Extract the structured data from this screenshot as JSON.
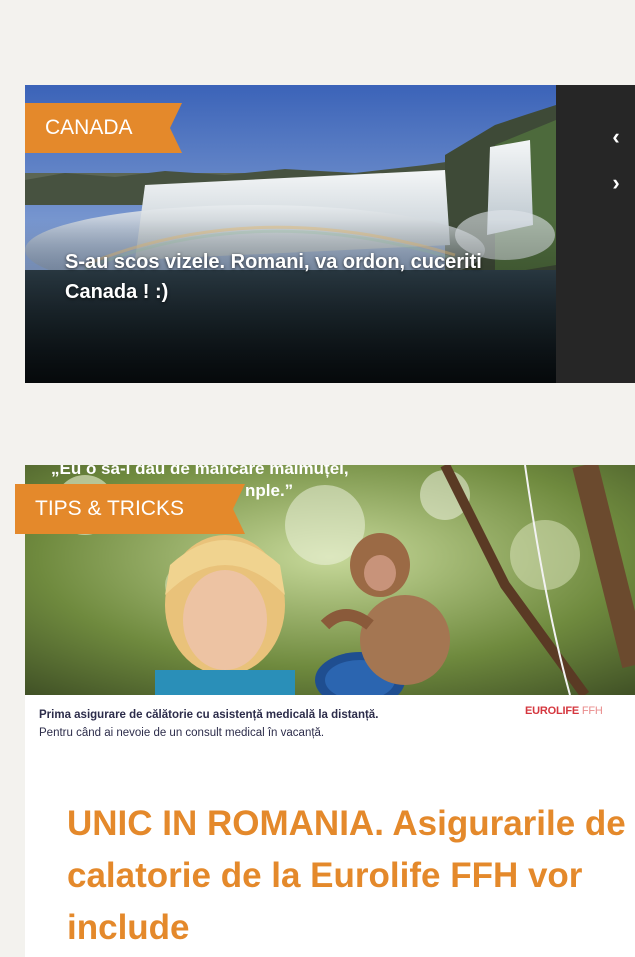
{
  "featured": {
    "category": "CANADA",
    "title": "S-au scos vizele. Romani, va ordon, cuceriti Canada ! :)",
    "prev_icon": "chevron-left-icon",
    "next_icon": "chevron-right-icon",
    "prev_glyph": "‹",
    "next_glyph": "›"
  },
  "article": {
    "category": "TIPS & TRICKS",
    "ad": {
      "quote_line1": "„Eu o sa-i dau de mancare maimuței,",
      "quote_line2": "nple.”",
      "line1": "Prima asigurare de călătorie cu asistență medicală la distanță.",
      "line2": "Pentru când ai nevoie de un consult medical în vacanță.",
      "brand": "EUROLIFE",
      "brand_suffix": "FFH"
    },
    "title": "UNIC IN ROMANIA. Asigurarile de calatorie de la Eurolife FFH vor include"
  },
  "colors": {
    "accent": "#e4892b",
    "page_bg": "#f3f2ee",
    "nav_bg": "#262626"
  }
}
